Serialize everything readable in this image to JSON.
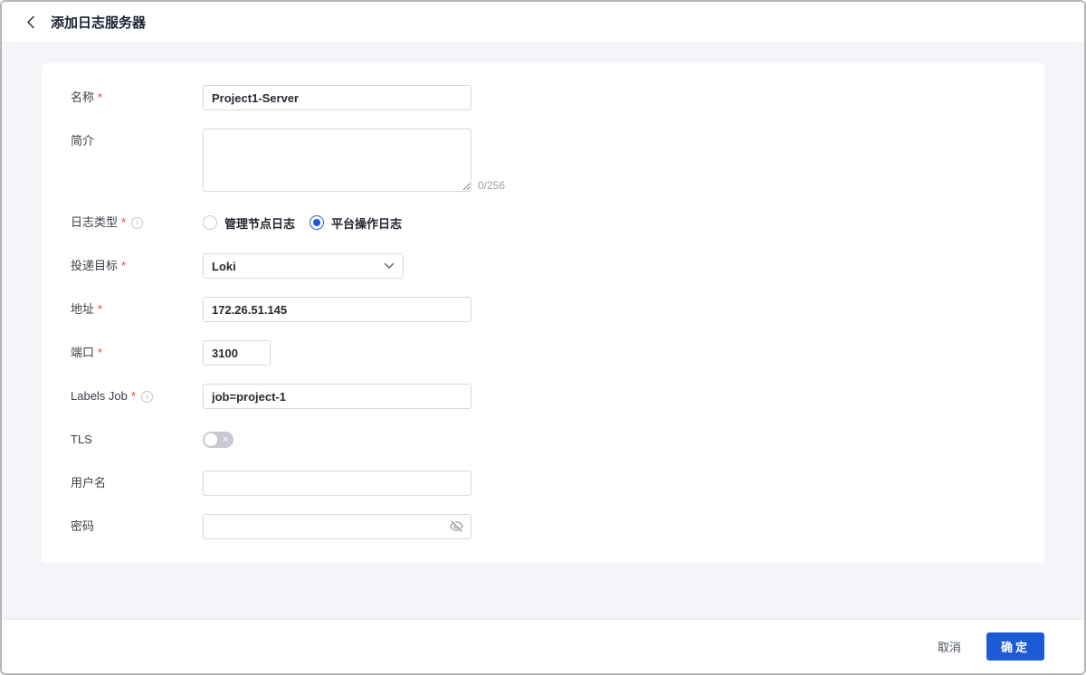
{
  "colors": {
    "accent": "#1d5bd6",
    "danger": "#ef3b3b"
  },
  "required_marker": "*",
  "header": {
    "title": "添加日志服务器",
    "back_icon": "chevron-left"
  },
  "form": {
    "name": {
      "label": "名称",
      "required": true,
      "value": "Project1-Server"
    },
    "description": {
      "label": "简介",
      "value": "",
      "counter": "0/256"
    },
    "log_type": {
      "label": "日志类型",
      "required": true,
      "info_icon": "circle-info",
      "options": [
        {
          "label": "管理节点日志",
          "selected": false
        },
        {
          "label": "平台操作日志",
          "selected": true
        }
      ]
    },
    "target": {
      "label": "投递目标",
      "required": true,
      "value": "Loki",
      "icon": "chevron-down"
    },
    "address": {
      "label": "地址",
      "required": true,
      "value": "172.26.51.145"
    },
    "port": {
      "label": "端口",
      "required": true,
      "value": "3100"
    },
    "labels_job": {
      "label": "Labels Job",
      "required": true,
      "info_icon": "circle-info",
      "value": "job=project-1"
    },
    "tls": {
      "label": "TLS",
      "enabled": false,
      "off_icon": "x-mark"
    },
    "username": {
      "label": "用户名",
      "value": ""
    },
    "password": {
      "label": "密码",
      "value": "",
      "icon": "eye-off"
    }
  },
  "footer": {
    "cancel_label": "取消",
    "confirm_label": "确定"
  }
}
